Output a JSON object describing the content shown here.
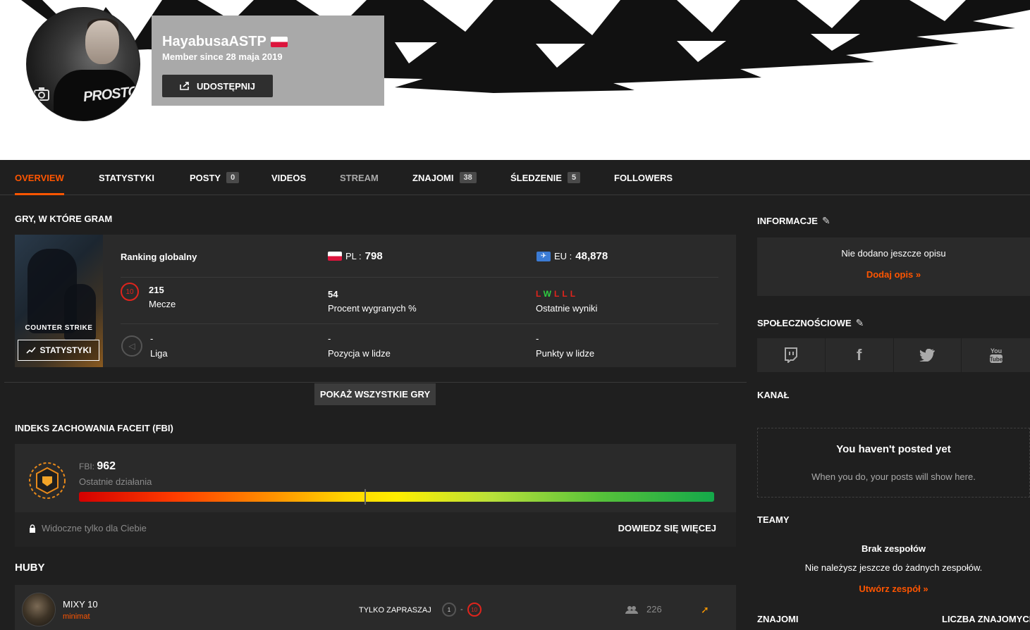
{
  "profile": {
    "username": "HayabusaASTP",
    "member_since": "Member since 28 maja 2019",
    "share_label": "UDOSTĘPNIJ"
  },
  "tabs": [
    {
      "label": "OVERVIEW"
    },
    {
      "label": "STATYSTYKI"
    },
    {
      "label": "POSTY",
      "badge": "0"
    },
    {
      "label": "VIDEOS"
    },
    {
      "label": "STREAM"
    },
    {
      "label": "ZNAJOMI",
      "badge": "38"
    },
    {
      "label": "ŚLEDZENIE",
      "badge": "5"
    },
    {
      "label": "FOLLOWERS"
    }
  ],
  "games": {
    "title": "GRY, W KTÓRE GRAM",
    "game_logo": "COUNTER STRIKE",
    "stats_button": "STATYSTYKI",
    "global_ranking_label": "Ranking globalny",
    "pl_label": "PL :",
    "pl_value": "798",
    "eu_label": "EU :",
    "eu_value": "48,878",
    "level": "10",
    "matches_value": "215",
    "matches_label": "Mecze",
    "winrate_value": "54",
    "winrate_label": "Procent wygranych %",
    "recent_results": [
      "L",
      "W",
      "L",
      "L",
      "L"
    ],
    "recent_label": "Ostatnie wyniki",
    "league_value": "-",
    "league_label": "Liga",
    "position_value": "-",
    "position_label": "Pozycja w lidze",
    "points_value": "-",
    "points_label": "Punkty w lidze",
    "show_all": "POKAŻ WSZYSTKIE GRY"
  },
  "fbi": {
    "title": "INDEKS ZACHOWANIA FACEIT (FBI)",
    "score_label": "FBI:",
    "score": "962",
    "subtitle": "Ostatnie działania",
    "visibility": "Widoczne tylko dla Ciebie",
    "learn_more": "DOWIEDZ SIĘ WIĘCEJ",
    "bar_position_fraction": 0.45
  },
  "hubs": {
    "title": "HUBY",
    "items": [
      {
        "name": "MIXY 10",
        "owner": "minimat",
        "join_type": "TYLKO ZAPRASZAJ",
        "min_level": "1",
        "max_level": "10",
        "members": "226"
      }
    ]
  },
  "sidebar": {
    "info_title": "INFORMACJE",
    "info_empty": "Nie dodano jeszcze opisu",
    "info_add": "Dodaj opis »",
    "social_title": "SPOŁECZNOŚCIOWE",
    "social_icons": [
      "twitch-icon",
      "facebook-icon",
      "twitter-icon",
      "youtube-icon"
    ],
    "channel_title": "KANAŁ",
    "channel_empty_title": "You haven't posted yet",
    "channel_empty_sub": "When you do, your posts will show here.",
    "teams_title": "TEAMY",
    "teams_empty_title": "Brak zespołów",
    "teams_empty_sub": "Nie należysz jeszcze do żadnych zespołów.",
    "teams_create": "Utwórz zespół »",
    "friends_title": "ZNAJOMI",
    "friends_count_title": "LICZBA ZNAJOMYCH"
  },
  "colors": {
    "accent": "#ff5500",
    "background": "#1f1f1f",
    "card": "#2a2a2a"
  }
}
